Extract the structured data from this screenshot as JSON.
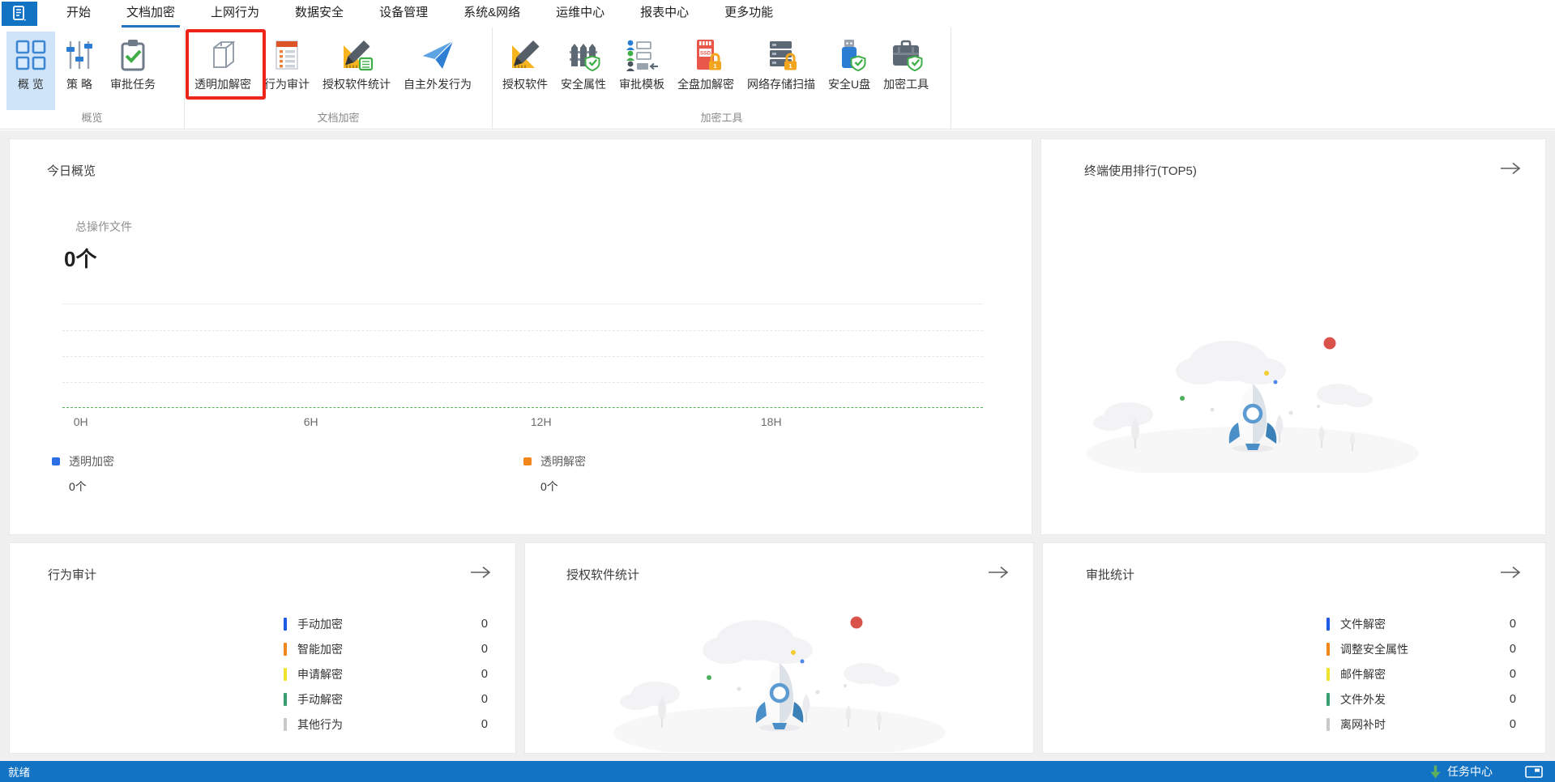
{
  "menu": {
    "tabs": [
      {
        "label": "开始",
        "active": false
      },
      {
        "label": "文档加密",
        "active": true
      },
      {
        "label": "上网行为",
        "active": false
      },
      {
        "label": "数据安全",
        "active": false
      },
      {
        "label": "设备管理",
        "active": false
      },
      {
        "label": "系统&网络",
        "active": false
      },
      {
        "label": "运维中心",
        "active": false
      },
      {
        "label": "报表中心",
        "active": false
      },
      {
        "label": "更多功能",
        "active": false
      }
    ]
  },
  "ribbon": {
    "groups": [
      {
        "label": "概览",
        "buttons": [
          {
            "label": "概 览",
            "icon": "overview-grid-icon",
            "selected": true
          },
          {
            "label": "策 略",
            "icon": "policy-sliders-icon",
            "selected": false
          },
          {
            "label": "审批任务",
            "icon": "approval-task-clipboard-icon",
            "selected": false
          }
        ]
      },
      {
        "label": "文档加密",
        "buttons": [
          {
            "label": "透明加解密",
            "icon": "transparent-crypt-cube-icon",
            "highlighted": true
          },
          {
            "label": "行为审计",
            "icon": "behavior-audit-doc-icon",
            "highlighted": false
          },
          {
            "label": "授权软件统计",
            "icon": "authorized-software-stats-icon",
            "highlighted": false
          },
          {
            "label": "自主外发行为",
            "icon": "outgoing-paper-plane-icon",
            "highlighted": false
          }
        ]
      },
      {
        "label": "加密工具",
        "buttons": [
          {
            "label": "授权软件",
            "icon": "authorized-software-ruler-pencil-icon"
          },
          {
            "label": "安全属性",
            "icon": "security-attribute-fence-shield-icon"
          },
          {
            "label": "审批模板",
            "icon": "approval-template-people-icon"
          },
          {
            "label": "全盘加解密",
            "icon": "full-disk-crypt-ssd-lock-icon"
          },
          {
            "label": "网络存储扫描",
            "icon": "network-storage-scan-server-lock-icon"
          },
          {
            "label": "安全U盘",
            "icon": "secure-usb-shield-icon"
          },
          {
            "label": "加密工具",
            "icon": "crypt-toolbox-shield-icon"
          }
        ]
      }
    ]
  },
  "panels": {
    "today": {
      "title": "今日概览",
      "total_label": "总操作文件",
      "total_value": "0个",
      "legend": [
        {
          "label": "透明加密",
          "value": "0个",
          "color": "#2b6fe3"
        },
        {
          "label": "透明解密",
          "value": "0个",
          "color": "#f0861c"
        }
      ]
    },
    "terminal_top5": {
      "title": "终端使用排行(TOP5)"
    },
    "behavior_audit": {
      "title": "行为审计",
      "items": [
        {
          "label": "手动加密",
          "value": "0",
          "color": "#1e5ce6"
        },
        {
          "label": "智能加密",
          "value": "0",
          "color": "#f0861c"
        },
        {
          "label": "申请解密",
          "value": "0",
          "color": "#efe32b"
        },
        {
          "label": "手动解密",
          "value": "0",
          "color": "#3a9e71"
        },
        {
          "label": "其他行为",
          "value": "0",
          "color": "#c9c9c9"
        }
      ]
    },
    "software_stats": {
      "title": "授权软件统计"
    },
    "approval_stats": {
      "title": "审批统计",
      "items": [
        {
          "label": "文件解密",
          "value": "0",
          "color": "#1e5ce6"
        },
        {
          "label": "调整安全属性",
          "value": "0",
          "color": "#f0861c"
        },
        {
          "label": "邮件解密",
          "value": "0",
          "color": "#efe32b"
        },
        {
          "label": "文件外发",
          "value": "0",
          "color": "#3a9e71"
        },
        {
          "label": "离网补时",
          "value": "0",
          "color": "#c9c9c9"
        }
      ]
    }
  },
  "statusbar": {
    "ready": "就绪",
    "task_center": "任务中心"
  },
  "chart_data": {
    "type": "line",
    "x_ticks": [
      "0H",
      "6H",
      "12H",
      "18H"
    ],
    "x_range_hours": [
      0,
      24
    ],
    "series": [
      {
        "name": "透明加密",
        "color": "#2b6fe3",
        "values": [
          0,
          0,
          0,
          0
        ]
      },
      {
        "name": "透明解密",
        "color": "#f0861c",
        "values": [
          0,
          0,
          0,
          0
        ]
      }
    ],
    "ylim": [
      0,
      4
    ],
    "grid": "horizontal-dashed",
    "baseline_color": "#57b158",
    "legend_position": "bottom"
  },
  "colors": {
    "accent_blue": "#1273c4",
    "tab_underline": "#2574c2",
    "selected_ribbon_bg": "#cfe4f8",
    "highlight_red": "#ee2418",
    "statusbar_bg": "#1273c4",
    "content_bg": "#f0f0f0",
    "panel_bg": "#ffffff"
  }
}
